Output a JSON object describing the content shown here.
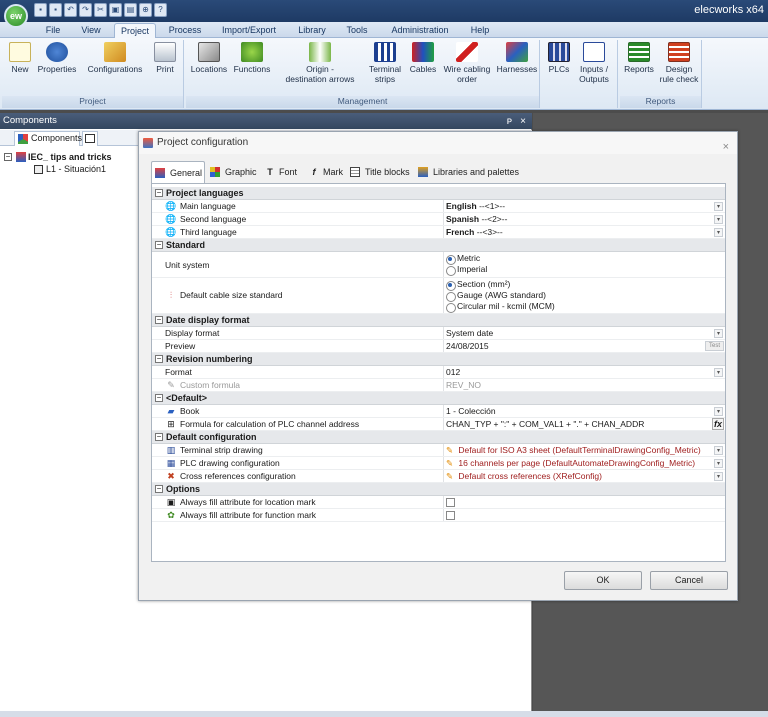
{
  "app": {
    "logo_text": "ew",
    "title": "elecworks x64"
  },
  "qat_icons": [
    "new-icon",
    "save-icon",
    "undo-icon",
    "redo-icon",
    "cut-icon",
    "copy-icon",
    "paste-icon",
    "zoom-icon",
    "help-icon"
  ],
  "menu": [
    "File",
    "View",
    "Project",
    "Process",
    "Import/Export",
    "Library",
    "Tools",
    "Administration",
    "Help"
  ],
  "active_menu": "Project",
  "ribbon": {
    "groups": [
      "Project",
      "Management",
      "Reports"
    ],
    "buttons": {
      "new": "New",
      "properties": "Properties",
      "configurations": "Configurations",
      "print": "Print",
      "locations": "Locations",
      "functions": "Functions",
      "origin_1": "Origin -",
      "origin_2": "destination arrows",
      "terminal_1": "Terminal",
      "terminal_2": "strips",
      "cables": "Cables",
      "wire_1": "Wire cabling",
      "wire_2": "order",
      "harnesses": "Harnesses",
      "plcs": "PLCs",
      "io_1": "Inputs /",
      "io_2": "Outputs",
      "reports": "Reports",
      "design_1": "Design",
      "design_2": "rule check"
    }
  },
  "panel": {
    "title": "Components",
    "pin": "ᴘ",
    "close": "×",
    "tab": "Components",
    "tree_root": "IEC_ tips and tricks",
    "tree_child": "L1 - Situación1"
  },
  "dialog": {
    "title": "Project configuration",
    "close": "×",
    "tabs": [
      "General",
      "Graphic",
      "Font",
      "Mark",
      "Title blocks",
      "Libraries and palettes"
    ],
    "sections": {
      "languages": "Project languages",
      "standard": "Standard",
      "date": "Date display format",
      "revision": "Revision numbering",
      "default": "<Default>",
      "defconf": "Default configuration",
      "options": "Options"
    },
    "rows": {
      "main_lang": "Main language",
      "main_lang_val": "English",
      "main_lang_code": "--<1>--",
      "second_lang": "Second language",
      "second_lang_val": "Spanish",
      "second_lang_code": "--<2>--",
      "third_lang": "Third language",
      "third_lang_val": "French",
      "third_lang_code": "--<3>--",
      "unit": "Unit system",
      "unit_metric": "Metric",
      "unit_imperial": "Imperial",
      "cable": "Default cable size standard",
      "cable_section": "Section (mm²)",
      "cable_gauge": "Gauge (AWG standard)",
      "cable_circular": "Circular mil - kcmil (MCM)",
      "display_format": "Display format",
      "display_format_val": "System date",
      "preview": "Preview",
      "preview_val": "24/08/2015",
      "test": "Test",
      "format": "Format",
      "format_val": "012",
      "custom": "Custom formula",
      "custom_val": "REV_NO",
      "book": "Book",
      "book_val": "1 - Colección",
      "plc_formula": "Formula for calculation of PLC channel address",
      "plc_formula_val": "CHAN_TYP + \":\" + COM_VAL1 + \".\" + CHAN_ADDR",
      "terminal": "Terminal strip drawing",
      "terminal_val": "Default for ISO A3 sheet (DefaultTerminalDrawingConfig_Metric)",
      "plc_draw": "PLC drawing configuration",
      "plc_draw_val": "16 channels per page (DefaultAutomateDrawingConfig_Metric)",
      "xref": "Cross references configuration",
      "xref_val": "Default cross references (XRefConfig)",
      "opt_location": "Always fill attribute for location mark",
      "opt_function": "Always fill attribute for function mark"
    },
    "ok": "OK",
    "cancel": "Cancel"
  },
  "colors": {
    "accent": "#2a4a78",
    "config_value": "#a02020",
    "dark_bg": "#565656"
  }
}
